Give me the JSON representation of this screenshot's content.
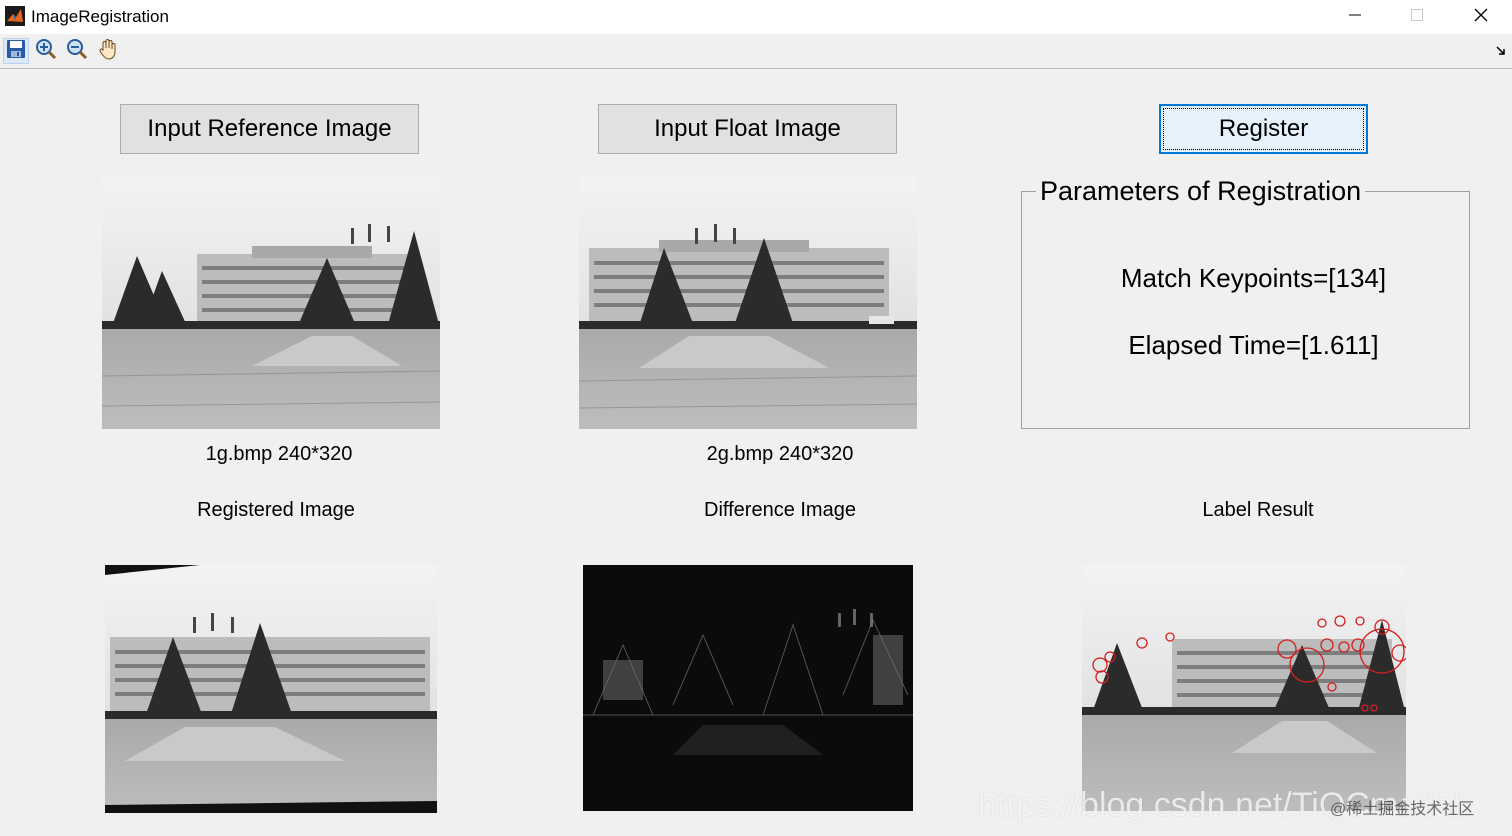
{
  "window": {
    "title": "ImageRegistration",
    "minimize_icon": "minimize-icon",
    "maximize_icon": "maximize-icon",
    "close_icon": "close-icon"
  },
  "toolbar": {
    "items": [
      {
        "name": "save-icon"
      },
      {
        "name": "zoom-in-icon"
      },
      {
        "name": "zoom-out-icon"
      },
      {
        "name": "pan-hand-icon"
      }
    ],
    "dock_icon": "dock-arrow-icon"
  },
  "buttons": {
    "input_reference": "Input Reference Image",
    "input_float": "Input Float Image",
    "register": "Register"
  },
  "captions": {
    "reference": "1g.bmp 240*320",
    "float": "2g.bmp 240*320",
    "registered": "Registered Image",
    "difference": "Difference Image",
    "label_result": "Label Result"
  },
  "parameters": {
    "title": "Parameters of Registration",
    "match_keypoints": "Match Keypoints=[134]",
    "elapsed_time": "Elapsed Time=[1.611]"
  },
  "watermark": {
    "url": "https://blog.csdn.net/TiQCmatlab",
    "credit": "@稀土掘金技术社区"
  },
  "colors": {
    "window_bg": "#f0f0f0",
    "focus_border": "#0078d7",
    "label_marks": "#d21f1f"
  }
}
